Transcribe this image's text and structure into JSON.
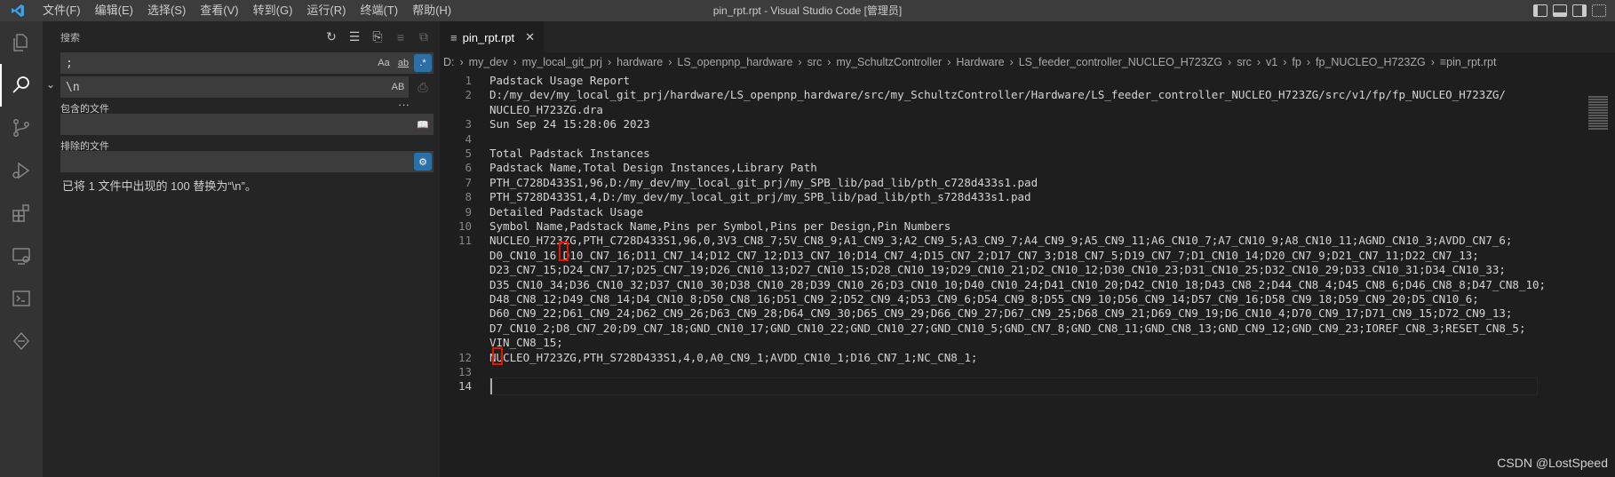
{
  "titlebar": {
    "menu": [
      "文件(F)",
      "编辑(E)",
      "选择(S)",
      "查看(V)",
      "转到(G)",
      "运行(R)",
      "终端(T)",
      "帮助(H)"
    ],
    "title": "pin_rpt.rpt - Visual Studio Code [管理员]",
    "accent": "#3c3c3c"
  },
  "activitybar": {
    "icons": [
      "explorer-icon",
      "search-icon",
      "source-control-icon",
      "run-debug-icon",
      "extensions-icon",
      "remote-explorer-icon",
      "terminal-icon",
      "extra-icon"
    ]
  },
  "sidebar": {
    "title": "搜索",
    "search_value": ";",
    "search_opts": [
      "Aa",
      "ab",
      ".*"
    ],
    "replace_value": "\\n",
    "replace_opt": "AB",
    "include_label": "包含的文件",
    "exclude_label": "排除的文件",
    "result_message": "已将 1 文件中出现的 100 替换为“\\n”。",
    "more": "···"
  },
  "editor": {
    "tab_label": "pin_rpt.rpt",
    "breadcrumb": [
      "D:",
      "my_dev",
      "my_local_git_prj",
      "hardware",
      "LS_openpnp_hardware",
      "src",
      "my_SchultzController",
      "Hardware",
      "LS_feeder_controller_NUCLEO_H723ZG",
      "src",
      "v1",
      "fp",
      "fp_NUCLEO_H723ZG",
      "pin_rpt.rpt"
    ],
    "lines": [
      {
        "n": "1",
        "text": "Padstack Usage Report"
      },
      {
        "n": "2",
        "text": "D:/my_dev/my_local_git_prj/hardware/LS_openpnp_hardware/src/my_SchultzController/Hardware/LS_feeder_controller_NUCLEO_H723ZG/src/v1/fp/fp_NUCLEO_H723ZG/"
      },
      {
        "n": "",
        "text": "NUCLEO_H723ZG.dra"
      },
      {
        "n": "3",
        "text": "Sun Sep 24 15:28:06 2023"
      },
      {
        "n": "4",
        "text": ""
      },
      {
        "n": "5",
        "text": "Total Padstack Instances"
      },
      {
        "n": "6",
        "text": "Padstack Name,Total Design Instances,Library Path"
      },
      {
        "n": "7",
        "text": "PTH_C728D433S1,96,D:/my_dev/my_local_git_prj/my_SPB_lib/pad_lib/pth_c728d433s1.pad"
      },
      {
        "n": "8",
        "text": "PTH_S728D433S1,4,D:/my_dev/my_local_git_prj/my_SPB_lib/pad_lib/pth_s728d433s1.pad"
      },
      {
        "n": "9",
        "text": "Detailed Padstack Usage"
      },
      {
        "n": "10",
        "text": "Symbol Name,Padstack Name,Pins per Symbol,Pins per Design,Pin Numbers"
      },
      {
        "n": "11",
        "text": "NUCLEO_H723ZG,PTH_C728D433S1,96,0,3V3_CN8_7;5V_CN8_9;A1_CN9_3;A2_CN9_5;A3_CN9_7;A4_CN9_9;A5_CN9_11;A6_CN10_7;A7_CN10_9;A8_CN10_11;AGND_CN10_3;AVDD_CN7_6;"
      },
      {
        "n": "",
        "text": "D0_CN10_16;D10_CN7_16;D11_CN7_14;D12_CN7_12;D13_CN7_10;D14_CN7_4;D15_CN7_2;D17_CN7_3;D18_CN7_5;D19_CN7_7;D1_CN10_14;D20_CN7_9;D21_CN7_11;D22_CN7_13;"
      },
      {
        "n": "",
        "text": "D23_CN7_15;D24_CN7_17;D25_CN7_19;D26_CN10_13;D27_CN10_15;D28_CN10_19;D29_CN10_21;D2_CN10_12;D30_CN10_23;D31_CN10_25;D32_CN10_29;D33_CN10_31;D34_CN10_33;"
      },
      {
        "n": "",
        "text": "D35_CN10_34;D36_CN10_32;D37_CN10_30;D38_CN10_28;D39_CN10_26;D3_CN10_10;D40_CN10_24;D41_CN10_20;D42_CN10_18;D43_CN8_2;D44_CN8_4;D45_CN8_6;D46_CN8_8;D47_CN8_10;"
      },
      {
        "n": "",
        "text": "D48_CN8_12;D49_CN8_14;D4_CN10_8;D50_CN8_16;D51_CN9_2;D52_CN9_4;D53_CN9_6;D54_CN9_8;D55_CN9_10;D56_CN9_14;D57_CN9_16;D58_CN9_18;D59_CN9_20;D5_CN10_6;"
      },
      {
        "n": "",
        "text": "D60_CN9_22;D61_CN9_24;D62_CN9_26;D63_CN9_28;D64_CN9_30;D65_CN9_29;D66_CN9_27;D67_CN9_25;D68_CN9_21;D69_CN9_19;D6_CN10_4;D70_CN9_17;D71_CN9_15;D72_CN9_13;"
      },
      {
        "n": "",
        "text": "D7_CN10_2;D8_CN7_20;D9_CN7_18;GND_CN10_17;GND_CN10_22;GND_CN10_27;GND_CN10_5;GND_CN7_8;GND_CN8_11;GND_CN8_13;GND_CN9_12;GND_CN9_23;IOREF_CN8_3;RESET_CN8_5;"
      },
      {
        "n": "",
        "text": "VIN_CN8_15;"
      },
      {
        "n": "12",
        "text": "NUCLEO_H723ZG,PTH_S728D433S1,4,0,A0_CN9_1;AVDD_CN10_1;D16_CN7_1;NC_CN8_1;"
      },
      {
        "n": "13",
        "text": ""
      },
      {
        "n": "14",
        "text": ""
      }
    ]
  },
  "watermark": "CSDN @LostSpeed"
}
